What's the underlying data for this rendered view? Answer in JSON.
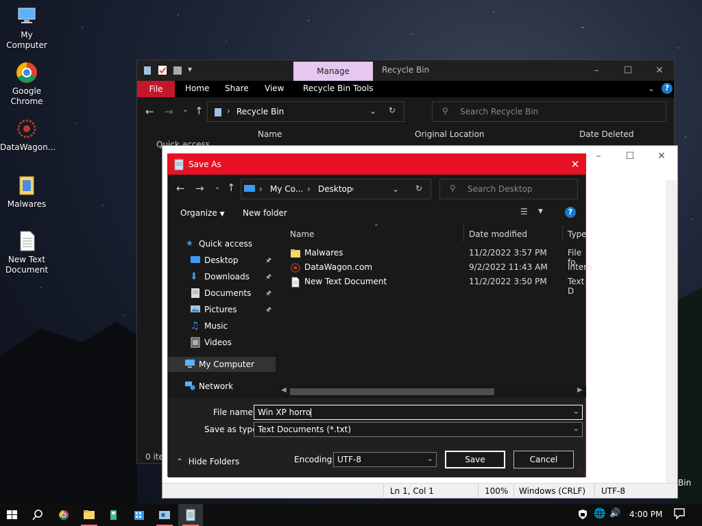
{
  "desktop": {
    "icons": [
      {
        "label": "My Computer"
      },
      {
        "label": "Google Chrome"
      },
      {
        "label": "DataWagon..."
      },
      {
        "label": "Malwares"
      },
      {
        "label": "New Text Document"
      }
    ]
  },
  "explorer": {
    "manage_tab": "Manage",
    "title": "Recycle Bin",
    "ribbon": {
      "file": "File",
      "home": "Home",
      "share": "Share",
      "view": "View",
      "tools": "Recycle Bin Tools"
    },
    "address": "Recycle Bin",
    "search_placeholder": "Search Recycle Bin",
    "columns": {
      "name": "Name",
      "original_location": "Original Location",
      "date_deleted": "Date Deleted"
    },
    "nav_partial": "Quick access",
    "status": "0 ite"
  },
  "notepad": {
    "status": {
      "position": "Ln 1, Col 1",
      "zoom": "100%",
      "line_ending": "Windows (CRLF)",
      "encoding": "UTF-8"
    },
    "side_text": "Bin"
  },
  "save_as": {
    "title": "Save As",
    "breadcrumb": {
      "root": "My Co...",
      "folder": "Desktop"
    },
    "search_placeholder": "Search Desktop",
    "toolbar": {
      "organize": "Organize",
      "new_folder": "New folder"
    },
    "nav": [
      {
        "label": "Quick access",
        "pinned": false
      },
      {
        "label": "Desktop",
        "pinned": true
      },
      {
        "label": "Downloads",
        "pinned": true
      },
      {
        "label": "Documents",
        "pinned": true
      },
      {
        "label": "Pictures",
        "pinned": true
      },
      {
        "label": "Music",
        "pinned": false
      },
      {
        "label": "Videos",
        "pinned": false
      },
      {
        "label": "My Computer",
        "pinned": false
      },
      {
        "label": "Network",
        "pinned": false
      }
    ],
    "columns": {
      "name": "Name",
      "date_modified": "Date modified",
      "type": "Type"
    },
    "files": [
      {
        "name": "Malwares",
        "date": "11/2/2022 3:57 PM",
        "type": "File fo"
      },
      {
        "name": "DataWagon.com",
        "date": "9/2/2022 11:43 AM",
        "type": "Intern"
      },
      {
        "name": "New Text Document",
        "date": "11/2/2022 3:50 PM",
        "type": "Text D"
      }
    ],
    "form": {
      "file_name_label": "File name:",
      "file_name_value": "Win XP horro",
      "save_type_label": "Save as type:",
      "save_type_value": "Text Documents (*.txt)",
      "encoding_label": "Encoding:",
      "encoding_value": "UTF-8",
      "save_button": "Save",
      "cancel_button": "Cancel",
      "hide_folders": "Hide Folders"
    }
  },
  "taskbar": {
    "time": "4:00 PM"
  },
  "colors": {
    "accent": "#e81123",
    "manage": "#e5c7f0",
    "ribbon_file": "#c4172c",
    "help": "#1979ca"
  }
}
